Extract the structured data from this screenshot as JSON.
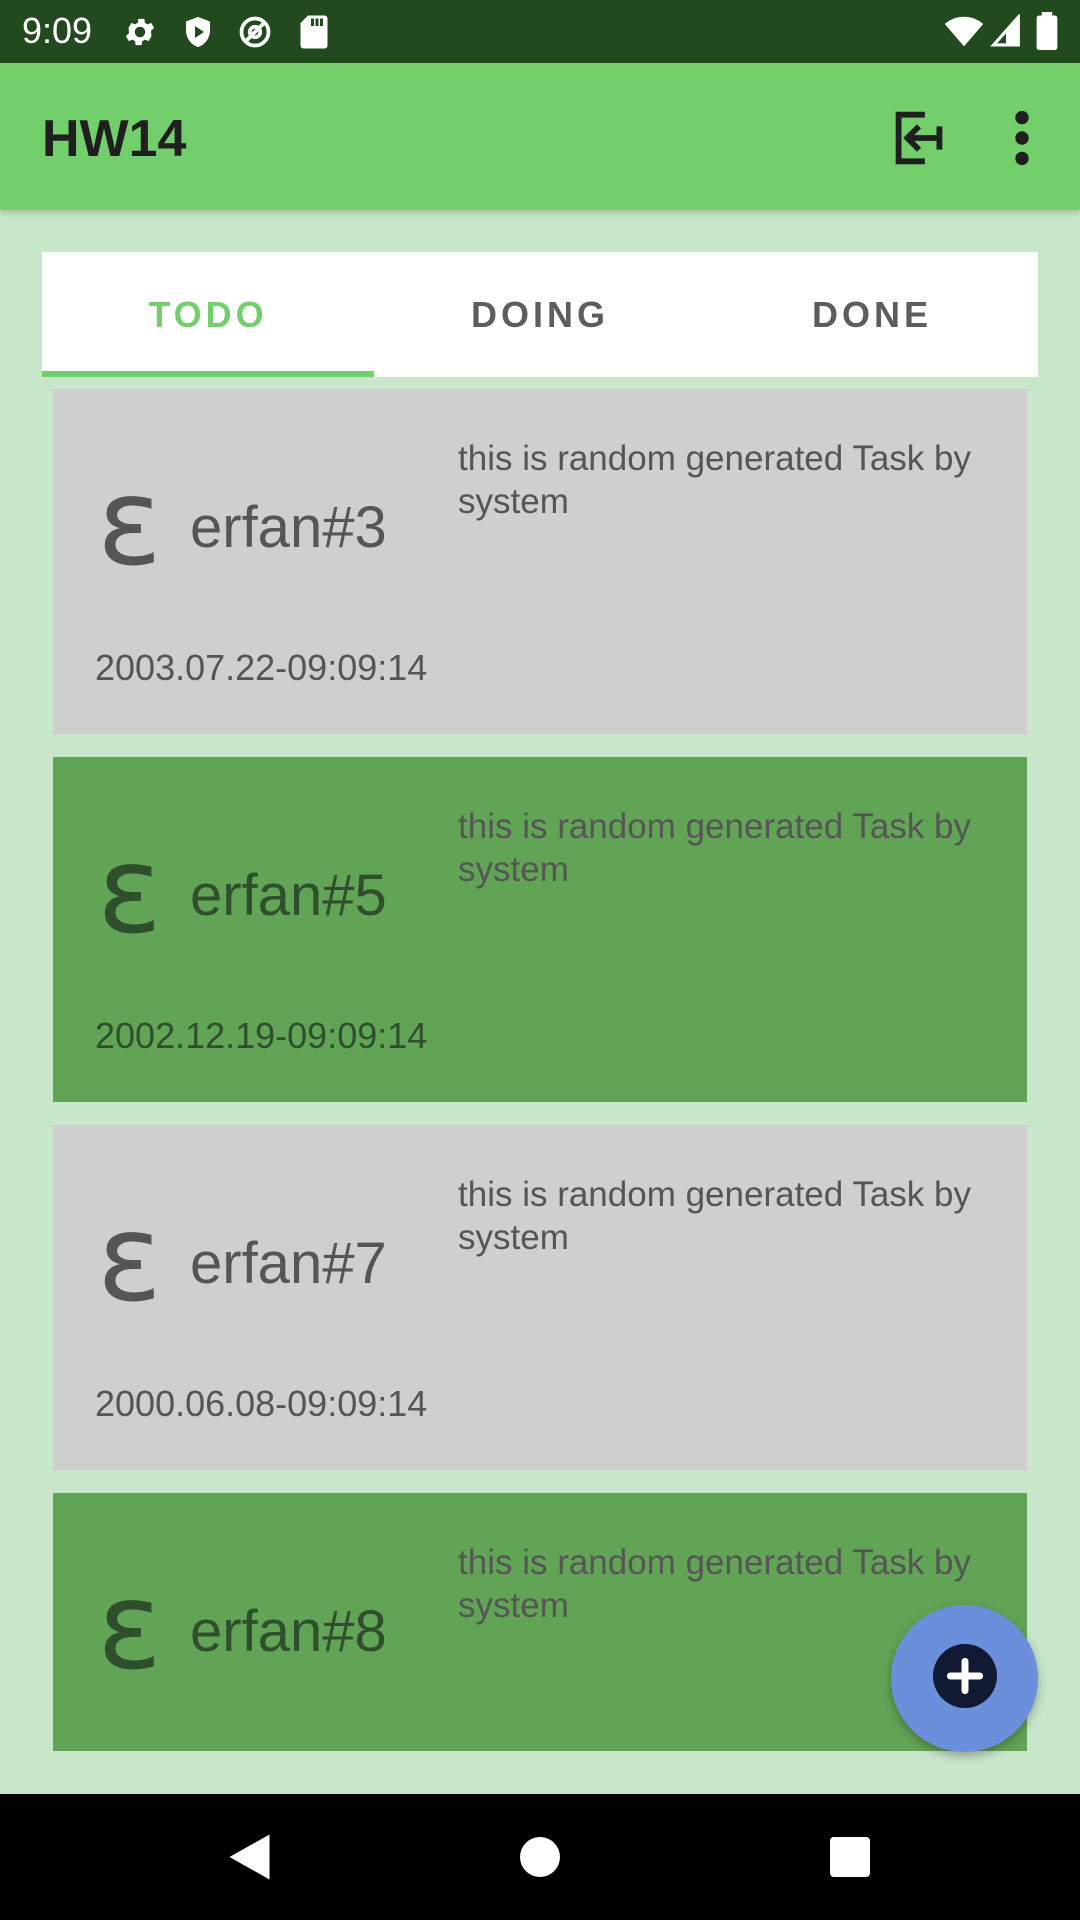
{
  "status_bar": {
    "time": "9:09",
    "icons_left": [
      "settings-icon",
      "shield-play-icon",
      "at-sign-icon",
      "sd-card-icon"
    ],
    "icons_right": [
      "wifi-icon",
      "signal-icon",
      "battery-icon"
    ]
  },
  "app_bar": {
    "title": "HW14",
    "actions": [
      "logout-icon",
      "more-vert-icon"
    ]
  },
  "tabs": [
    {
      "label": "TODO",
      "active": true
    },
    {
      "label": "DOING",
      "active": false
    },
    {
      "label": "DONE",
      "active": false
    }
  ],
  "tasks": [
    {
      "avatar": "ɛ",
      "title": "erfan#3",
      "description": "this is random generated Task by system",
      "date": "2003.07.22-09:09:14",
      "color": "#cfcfcf"
    },
    {
      "avatar": "ɛ",
      "title": "erfan#5",
      "description": "this is random generated Task by system",
      "date": "2002.12.19-09:09:14",
      "color": "#62a456"
    },
    {
      "avatar": "ɛ",
      "title": "erfan#7",
      "description": "this is random generated Task by system",
      "date": "2000.06.08-09:09:14",
      "color": "#cfcfcf"
    },
    {
      "avatar": "ɛ",
      "title": "erfan#8",
      "description": "this is random generated Task by system",
      "date": "",
      "color": "#62a456"
    }
  ],
  "fab": {
    "icon": "add-circle-icon"
  },
  "nav_bar": {
    "buttons": [
      "back-icon",
      "home-icon",
      "recents-icon"
    ]
  },
  "colors": {
    "accent": "#72cf6c",
    "status_bar": "#234a1e",
    "background": "#c8e6c9",
    "fab": "#6c8fdb"
  }
}
